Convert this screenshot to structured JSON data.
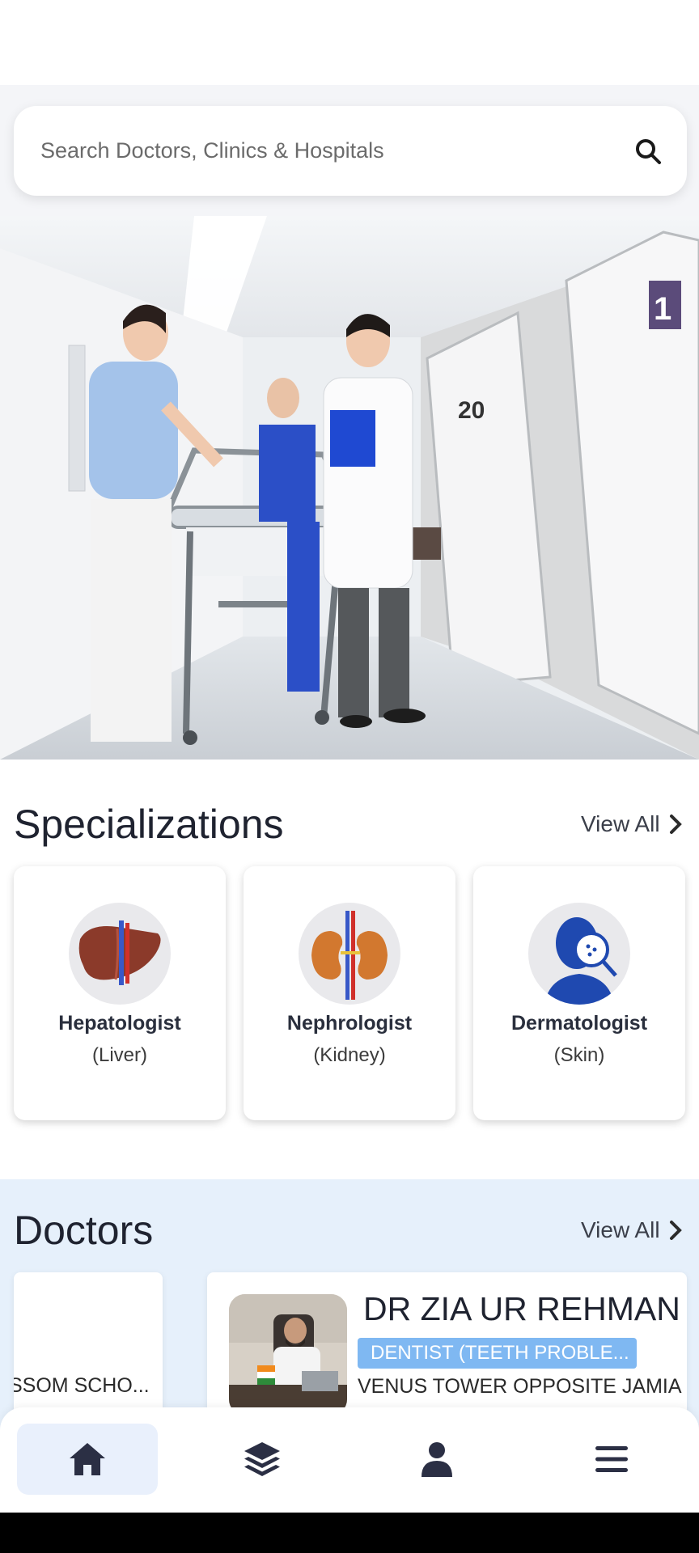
{
  "search": {
    "placeholder": "Search Doctors, Clinics & Hospitals"
  },
  "specializations": {
    "title": "Specializations",
    "view_all": "View All",
    "items": [
      {
        "name": "Hepatologist",
        "sub": "(Liver)",
        "icon": "liver-icon"
      },
      {
        "name": "Nephrologist",
        "sub": "(Kidney)",
        "icon": "kidney-icon"
      },
      {
        "name": "Dermatologist",
        "sub": "(Skin)",
        "icon": "skin-icon"
      }
    ]
  },
  "doctors": {
    "title": "Doctors",
    "view_all": "View All",
    "partial_card": {
      "address": "SSOM SCHO..."
    },
    "main_card": {
      "name": "DR ZIA UR REHMAN",
      "specialty": "DENTIST (TEETH PROBLE...",
      "address": "VENUS TOWER OPPOSITE JAMIA U"
    }
  },
  "nav": {
    "items": [
      {
        "icon": "home-icon",
        "active": true
      },
      {
        "icon": "layers-icon",
        "active": false
      },
      {
        "icon": "user-icon",
        "active": false
      },
      {
        "icon": "menu-icon",
        "active": false
      }
    ]
  },
  "colors": {
    "accent_light": "#e9f0fc",
    "doctors_band": "#e6f0fb",
    "badge": "#7fb8f2",
    "nav_icon": "#2b2f44"
  }
}
